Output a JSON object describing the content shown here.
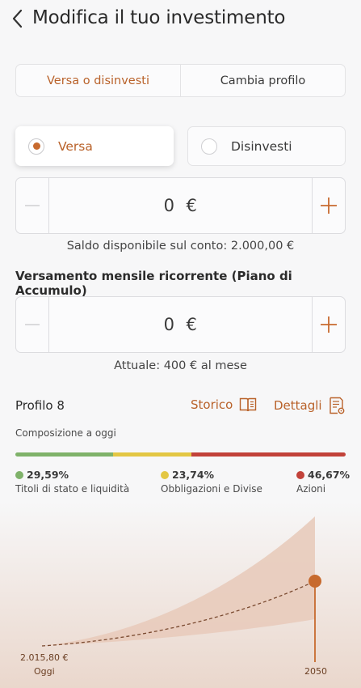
{
  "header": {
    "title": "Modifica il tuo investimento",
    "back_icon": "chevron-left-icon"
  },
  "tabs": [
    {
      "label": "Versa o disinvesti",
      "active": true
    },
    {
      "label": "Cambia profilo",
      "active": false
    }
  ],
  "operation": {
    "options": [
      {
        "label": "Versa",
        "selected": true
      },
      {
        "label": "Disinvesti",
        "selected": false
      }
    ]
  },
  "one_time": {
    "value": "0",
    "currency": "€",
    "caption": "Saldo disponibile sul conto: 2.000,00 €"
  },
  "recurring": {
    "title": "Versamento mensile ricorrente (Piano di Accumulo)",
    "value": "0",
    "currency": "€",
    "caption": "Attuale: 400 € al mese"
  },
  "profile": {
    "name": "Profilo 8",
    "history_label": "Storico",
    "history_icon": "book-icon",
    "details_label": "Dettagli",
    "details_icon": "document-settings-icon",
    "composition_label": "Composizione a oggi"
  },
  "allocation": [
    {
      "percent": "29,59%",
      "label": "Titoli di stato e liquidità",
      "color": "#7fb26a",
      "share": 29.59
    },
    {
      "percent": "23,74%",
      "label": "Obbligazioni e Divise",
      "color": "#e3c744",
      "share": 23.74
    },
    {
      "percent": "46,67%",
      "label": "Azioni",
      "color": "#c2423a",
      "share": 46.67
    }
  ],
  "colors": {
    "accent": "#b9622a",
    "accent_dot": "#c76a2e"
  },
  "chart": {
    "start_value": "2.015,80 €",
    "start_label": "Oggi",
    "end_label": "2050"
  }
}
